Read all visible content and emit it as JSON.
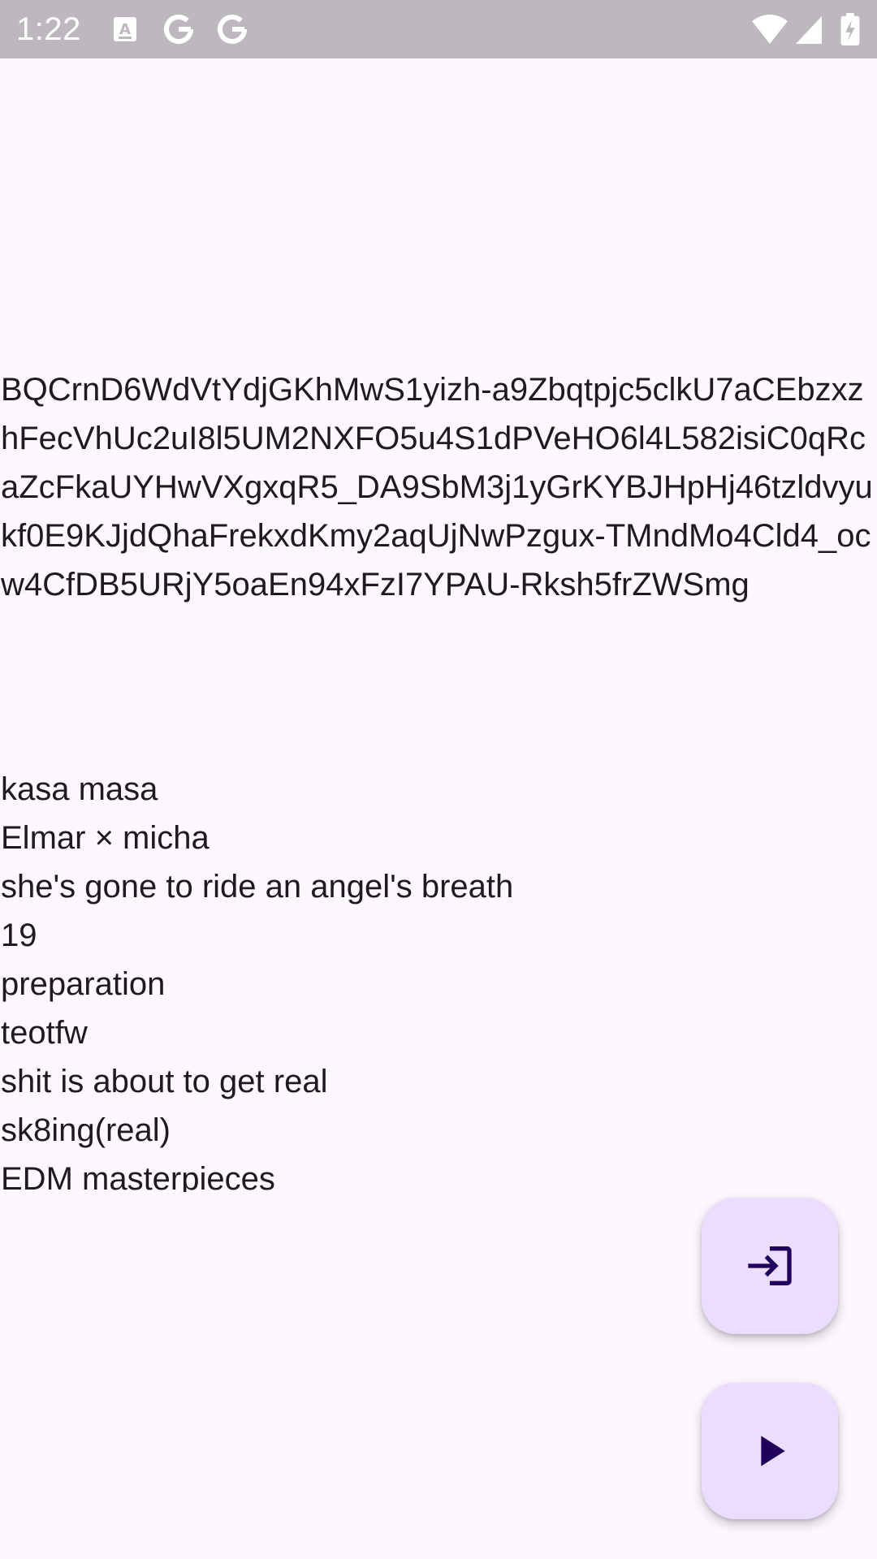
{
  "status_bar": {
    "time": "1:22",
    "left_icons": [
      "text-a-icon",
      "google-icon",
      "google-icon"
    ],
    "right_icons": [
      "wifi-icon",
      "signal-icon",
      "battery-icon"
    ]
  },
  "token_text": "BQCrnD6WdVtYdjGKhMwS1yizh-a9Zbqtpjc5clkU7aCEbzxzhFecVhUc2uI8l5UM2NXFO5u4S1dPVeHO6l4L582isiC0qRcaZcFkaUYHwVXgxqR5_DA9SbM3j1yGrKYBJHpHj46tzldvyukf0E9KJjdQhaFrekxdKmy2aqUjNwPzgux-TMndMo4Cld4_ocw4CfDB5URjY5oaEn94xFzI7YPAU-Rksh5frZWSmg",
  "playlists": [
    "kasa masa",
    "Elmar × micha",
    "she's gone to ride an angel's breath",
    "19",
    "preparation",
    "teotfw",
    "shit is about to get real",
    "sk8ing(real)",
    "EDM masterpieces"
  ],
  "fabs": {
    "login_icon": "login-icon",
    "play_icon": "play-icon"
  },
  "colors": {
    "background": "#fef7ff",
    "status_bar": "#bcb8be",
    "fab_container": "#eaddff",
    "fab_icon": "#21005d",
    "text": "#1d1b20"
  }
}
